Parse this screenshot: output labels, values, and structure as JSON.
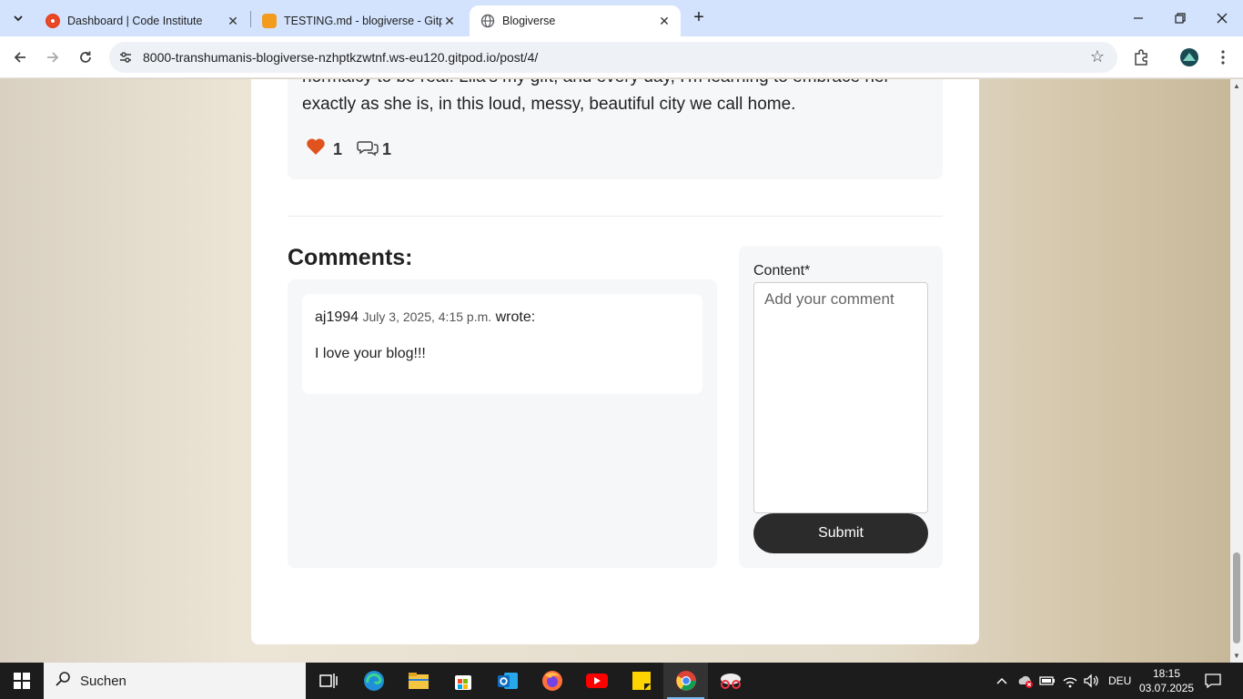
{
  "browser": {
    "tabs": [
      {
        "title": "Dashboard | Code Institute",
        "favicon_color": "#e8421f",
        "active": false
      },
      {
        "title": "TESTING.md - blogiverse - Gitp",
        "favicon_color": "#f29b1d",
        "active": false
      },
      {
        "title": "Blogiverse",
        "favicon_color": "#5f6368",
        "active": true
      }
    ],
    "url": "8000-transhumanis-blogiverse-nzhptkzwtnf.ws-eu120.gitpod.io/post/4/"
  },
  "post": {
    "text_partial_top": "normalcy to be real. Lila's my gift, and every day, I'm learning to embrace her",
    "text_last_line": "exactly as she is, in this loud, messy, beautiful city we call home.",
    "likes": "1",
    "comments_count": "1"
  },
  "comments": {
    "title": "Comments:",
    "items": [
      {
        "author": "aj1994",
        "date": "July 3, 2025, 4:15 p.m.",
        "wrote": "wrote:",
        "body": "I love your blog!!!"
      }
    ]
  },
  "form": {
    "label": "Content*",
    "placeholder": "Add your comment",
    "submit_label": "Submit"
  },
  "taskbar": {
    "search_label": "Suchen",
    "language": "DEU",
    "time": "18:15",
    "date": "03.07.2025"
  },
  "colors": {
    "heart": "#e0531f",
    "submit_bg": "#2b2b2b",
    "tabbar_bg": "#d3e3fd"
  }
}
